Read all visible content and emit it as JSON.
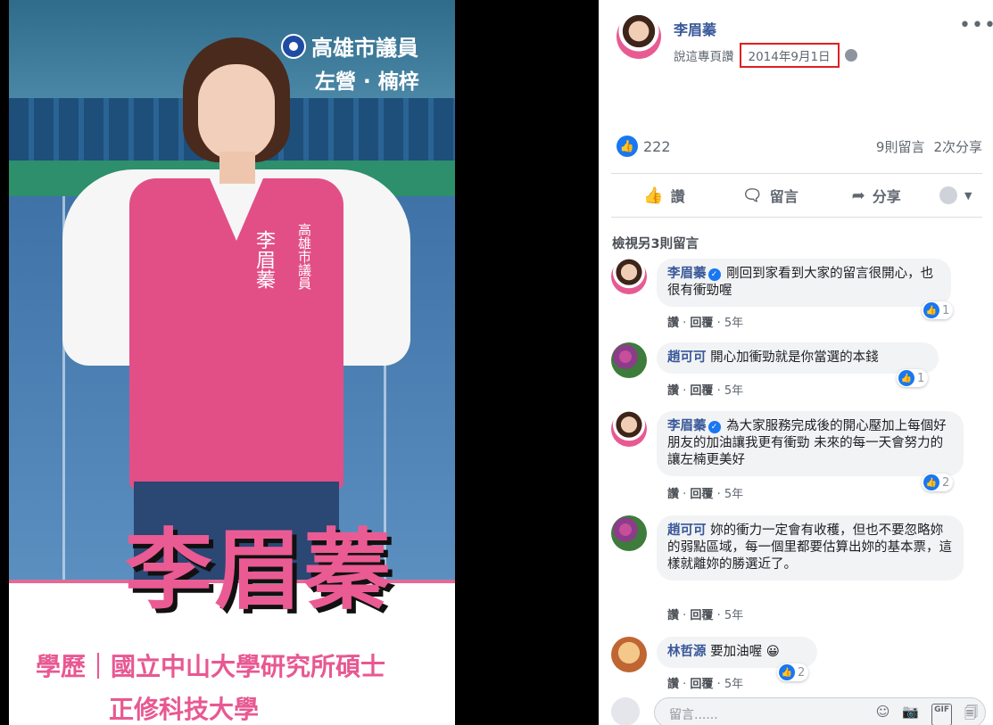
{
  "poster": {
    "party_badge": "高雄市議員",
    "district": "左營 · 楠梓",
    "vest_name": "李眉蓁",
    "vest_title": "高雄市議員",
    "big_name": "李眉蓁",
    "education_line1": "學歷｜國立中山大學研究所碩士",
    "education_line2": "正修科技大學"
  },
  "post": {
    "author": "李眉蓁",
    "meta_prefix": "說這專頁讚",
    "date": "2014年9月1日",
    "more": "•••",
    "like_count": "222",
    "comment_count": "9則留言",
    "share_count": "2次分享",
    "actions": {
      "like": "讚",
      "comment": "留言",
      "share": "分享"
    },
    "view_more": "檢視另3則留言"
  },
  "comments": [
    {
      "author": "李眉蓁",
      "text": "剛回到家看到大家的留言很開心，也很有衝勁喔",
      "likes": "1",
      "like_label": "讚",
      "reply_label": "回覆",
      "time": "5年"
    },
    {
      "author": "趙可可",
      "text": "開心加衝勁就是你當選的本錢",
      "likes": "1",
      "like_label": "讚",
      "reply_label": "回覆",
      "time": "5年"
    },
    {
      "author": "李眉蓁",
      "text": "為大家服務完成後的開心壓加上每個好朋友的加油讓我更有衝勁 未來的每一天會努力的讓左楠更美好",
      "likes": "2",
      "like_label": "讚",
      "reply_label": "回覆",
      "time": "5年"
    },
    {
      "author": "趙可可",
      "text": "妳的衝力一定會有收穫，但也不要忽略妳的弱點區域，每一個里都要估算出妳的基本票，這樣就離妳的勝選近了。",
      "likes": "",
      "like_label": "讚",
      "reply_label": "回覆",
      "time": "5年"
    },
    {
      "author": "林哲源",
      "text": "要加油喔 😀",
      "likes": "2",
      "like_label": "讚",
      "reply_label": "回覆",
      "time": "5年"
    }
  ],
  "composer": {
    "placeholder": "留言......"
  },
  "colors": {
    "link": "#385898",
    "like_blue": "#1877f2",
    "date_highlight": "#e02020",
    "poster_pink": "#ea5b93"
  }
}
